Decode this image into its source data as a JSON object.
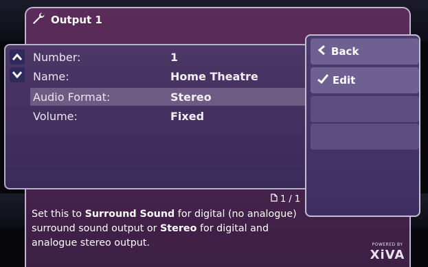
{
  "window": {
    "title": "Output 1",
    "title_icon": "wrench-icon"
  },
  "rows": [
    {
      "label": "Number:",
      "value": "1"
    },
    {
      "label": "Name:",
      "value": "Home Theatre"
    },
    {
      "label": "Audio Format:",
      "value": "Stereo",
      "selected": true
    },
    {
      "label": "Volume:",
      "value": "Fixed"
    }
  ],
  "scroll": {
    "up_icon": "chevron-up-icon",
    "down_icon": "chevron-down-icon"
  },
  "actions": [
    {
      "label": "Back",
      "icon": "chevron-left-icon"
    },
    {
      "label": "Edit",
      "icon": "checkmark-icon"
    }
  ],
  "pagination": {
    "text": "1 / 1",
    "icon": "page-icon"
  },
  "description": {
    "part1": "Set this to ",
    "bold1": "Surround Sound",
    "part2": " for digital (no analogue) surround sound output or ",
    "bold2": "Stereo",
    "part3": " for digital and analogue stereo output."
  },
  "branding": {
    "powered_by": "POWERED BY",
    "brand": "XiVA"
  },
  "colors": {
    "panel_purple": "#4e2552",
    "selected_row": "#6d5b84",
    "button": "#6f6092"
  }
}
